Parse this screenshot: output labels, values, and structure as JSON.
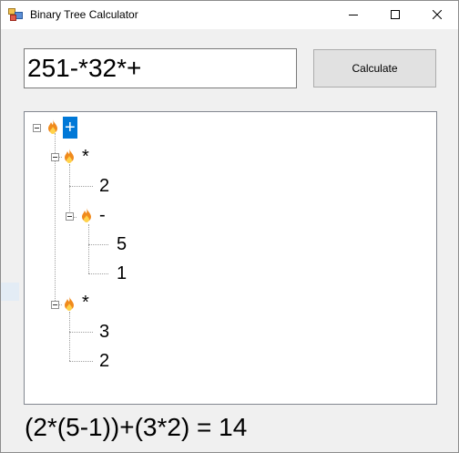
{
  "window": {
    "title": "Binary Tree Calculator",
    "icon": "app-icon",
    "controls": [
      "minimize-icon",
      "maximize-icon",
      "close-icon"
    ]
  },
  "input": {
    "value": "251-*32*+"
  },
  "calculate_button": {
    "label": "Calculate"
  },
  "tree": {
    "node_icon": "flame-icon",
    "nodes": [
      {
        "label": "+",
        "selected": true,
        "expanded": true
      },
      {
        "label": "*",
        "expanded": true
      },
      {
        "label": "2"
      },
      {
        "label": "-",
        "expanded": true
      },
      {
        "label": "5"
      },
      {
        "label": "1"
      },
      {
        "label": "*",
        "expanded": true
      },
      {
        "label": "3"
      },
      {
        "label": "2"
      }
    ]
  },
  "result": {
    "text": "(2*(5-1))+(3*2) = 14"
  },
  "colors": {
    "selection": "#0078d7",
    "background": "#f0f0f0"
  }
}
